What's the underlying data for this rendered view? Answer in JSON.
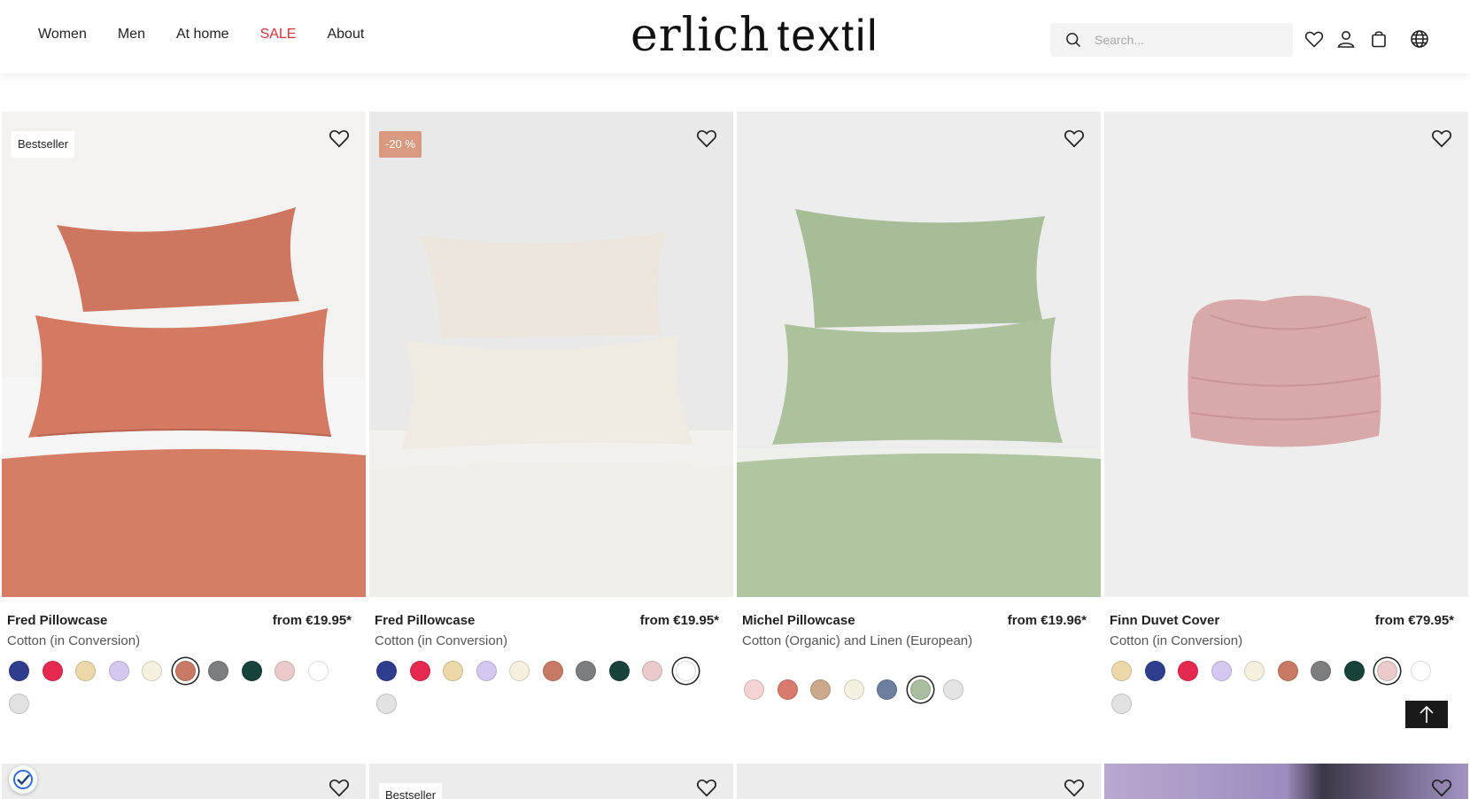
{
  "header": {
    "nav": [
      "Women",
      "Men",
      "At home",
      "SALE",
      "About"
    ],
    "logo_main": "erlich",
    "logo_light": "textil",
    "search_placeholder": "Search...",
    "icons": [
      "wishlist-icon",
      "account-icon",
      "cart-icon",
      "globe-icon"
    ],
    "sale_color": "#d6323b"
  },
  "products": [
    {
      "badge": "Bestseller",
      "name": "Fred Pillowcase",
      "price": "from €19.95*",
      "material": "Cotton (in Conversion)",
      "photo_color": "#d47a62",
      "swatches": [
        "#2e3d8e",
        "#e6294f",
        "#ecd8a8",
        "#d4c8f0",
        "#f6f0de",
        "#c97a64",
        "#7b7d7e",
        "#17433a",
        "#eacaca",
        "#ffffff",
        "#e2e2e2"
      ],
      "selected_swatch": 5
    },
    {
      "badge": "-20 %",
      "name": "Fred Pillowcase",
      "price": "from €19.95*",
      "material": "Cotton (in Conversion)",
      "photo_color": "#ebe6de",
      "swatches": [
        "#2e3d8e",
        "#e6294f",
        "#ecd8a8",
        "#d4c8f0",
        "#f6f0de",
        "#c97a64",
        "#7b7d7e",
        "#17433a",
        "#eacaca",
        "#ffffff",
        "#e2e2e2"
      ],
      "selected_swatch": 9
    },
    {
      "badge": "",
      "name": "Michel Pillowcase",
      "price": "from €19.96*",
      "material": "Cotton (Organic) and Linen (European)",
      "photo_color": "#a9c19a",
      "swatches": [
        "#f3d4d2",
        "#d97b6c",
        "#c9a98a",
        "#f4f1e0",
        "#6c7f9e",
        "#a9bd9f",
        "#e4e4e4"
      ],
      "selected_swatch": 5
    },
    {
      "badge": "",
      "name": "Finn Duvet Cover",
      "price": "from €79.95*",
      "material": "Cotton (in Conversion)",
      "photo_color": "#d9a8a8",
      "swatches": [
        "#ecd8a8",
        "#2e3d8e",
        "#e6294f",
        "#d4c8f0",
        "#f6f0de",
        "#c97a64",
        "#7b7d7e",
        "#17433a",
        "#eacaca",
        "#ffffff",
        "#e2e2e2"
      ],
      "selected_swatch": 8
    }
  ],
  "row2_badges": [
    "",
    "Bestseller",
    "",
    ""
  ]
}
